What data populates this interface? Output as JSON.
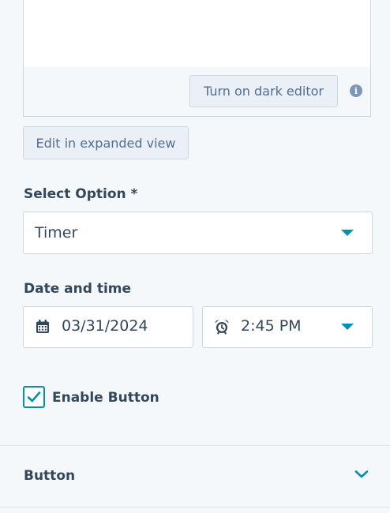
{
  "editor": {
    "dark_editor_label": "Turn on dark editor",
    "info_icon": "info-icon",
    "expanded_view_label": "Edit in expanded view"
  },
  "select_option": {
    "label": "Select Option *",
    "value": "Timer"
  },
  "date_time": {
    "label": "Date and time",
    "date_value": "03/31/2024",
    "time_value": "2:45 PM",
    "date_icon": "calendar-icon",
    "time_icon": "alarm-clock-icon"
  },
  "enable_button": {
    "label": "Enable Button",
    "checked": true
  },
  "section": {
    "title": "Button",
    "icon": "chevron-down-icon"
  },
  "colors": {
    "accent": "#0091ae",
    "text": "#33475b",
    "background": "#f5f8fa",
    "border": "#cbd6e2"
  }
}
